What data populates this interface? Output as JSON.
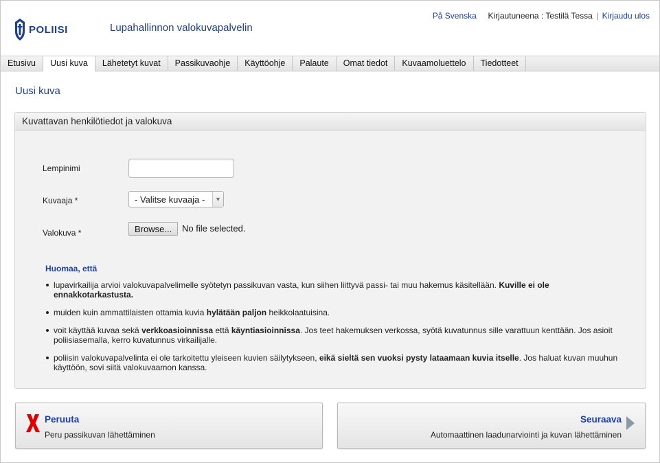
{
  "header": {
    "logo_text": "POLIISI",
    "app_title": "Lupahallinnon valokuvapalvelin",
    "lang_link": "På Svenska",
    "logged_in_label": "Kirjautuneena : Testilä Tessa",
    "separator": "|",
    "logout_link": "Kirjaudu ulos"
  },
  "nav": {
    "tabs": [
      {
        "label": "Etusivu"
      },
      {
        "label": "Uusi kuva"
      },
      {
        "label": "Lähetetyt kuvat"
      },
      {
        "label": "Passikuvaohje"
      },
      {
        "label": "Käyttöohje"
      },
      {
        "label": "Palaute"
      },
      {
        "label": "Omat tiedot"
      },
      {
        "label": "Kuvaamoluettelo"
      },
      {
        "label": "Tiedotteet"
      }
    ],
    "active": "Uusi kuva"
  },
  "page": {
    "title": "Uusi kuva"
  },
  "form": {
    "panel_title": "Kuvattavan henkilötiedot ja valokuva",
    "nickname_label": "Lempinimi",
    "nickname_value": "",
    "photographer_label": "Kuvaaja *",
    "photographer_selected": "- Valitse kuvaaja -",
    "photo_label": "Valokuva *",
    "browse_label": "Browse...",
    "file_status": "No file selected."
  },
  "notice": {
    "title": "Huomaa, että",
    "items": [
      {
        "a": "lupavirkailija arvioi valokuvapalvelimelle syötetyn passikuvan vasta, kun siihen liittyvä passi- tai muu hakemus käsitellään. ",
        "b": "Kuville ei ole ennakkotarkastusta.",
        "c": ""
      },
      {
        "a": "muiden kuin ammattilaisten ottamia kuvia ",
        "b": "hylätään paljon",
        "c": " heikkolaatuisina."
      },
      {
        "a": "voit käyttää kuvaa sekä ",
        "b": "verkkoasioinnissa",
        "c": " että ",
        "d": "käyntiasioinnissa",
        "e": ". Jos teet hakemuksen verkossa, syötä kuvatunnus sille varattuun kenttään. Jos asioit poliisiasemalla, kerro kuvatunnus virkailijalle."
      },
      {
        "a": "poliisin valokuvapalvelinta ei ole tarkoitettu yleiseen kuvien säilytykseen, ",
        "b": "eikä sieltä sen vuoksi pysty lataamaan kuvia itselle",
        "c": ". Jos haluat kuvan muuhun käyttöön, sovi siitä valokuvaamon kanssa."
      }
    ]
  },
  "actions": {
    "cancel_title": "Peruuta",
    "cancel_desc": "Peru passikuvan lähettäminen",
    "next_title": "Seuraava",
    "next_desc": "Automaattinen laadunarviointi ja kuvan lähettäminen"
  },
  "colors": {
    "brand": "#1d3f8f",
    "link": "#1d3fb0",
    "cancel_icon": "#e00000",
    "next_arrow": "#8c9aa8"
  }
}
